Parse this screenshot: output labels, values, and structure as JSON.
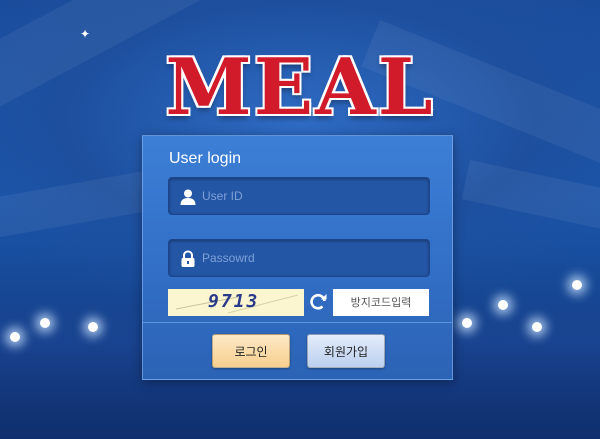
{
  "logo": {
    "text": "MEAL"
  },
  "login": {
    "title": "User login",
    "userid_placeholder": "User ID",
    "password_placeholder": "Passowrd",
    "captcha_code": "9713",
    "captcha_placeholder": "방지코드입력",
    "login_button": "로그인",
    "signup_button": "회원가입"
  },
  "icons": {
    "user": "user-icon",
    "lock": "lock-icon",
    "refresh": "refresh-icon"
  },
  "colors": {
    "logo_red": "#d11a2a",
    "panel_blue": "#3370c8",
    "login_button": "#f6cf8e",
    "signup_button": "#bcd0ef"
  }
}
